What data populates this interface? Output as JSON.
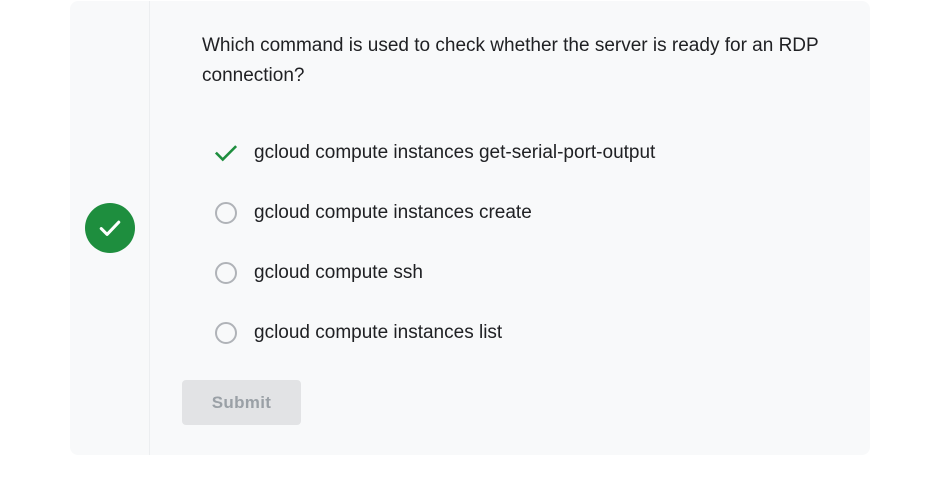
{
  "quiz": {
    "question": "Which command is used to check whether the server is ready for an RDP connection?",
    "status": "correct",
    "status_icon": "check-circle-icon",
    "accent_color": "#1e8e3e",
    "options": [
      {
        "label": "gcloud compute instances get-serial-port-output",
        "marker": "check-icon",
        "selected": true
      },
      {
        "label": "gcloud compute instances create",
        "marker": "radio-empty",
        "selected": false
      },
      {
        "label": "gcloud compute ssh",
        "marker": "radio-empty",
        "selected": false
      },
      {
        "label": "gcloud compute instances list",
        "marker": "radio-empty",
        "selected": false
      }
    ],
    "submit_label": "Submit",
    "submit_disabled": true
  }
}
